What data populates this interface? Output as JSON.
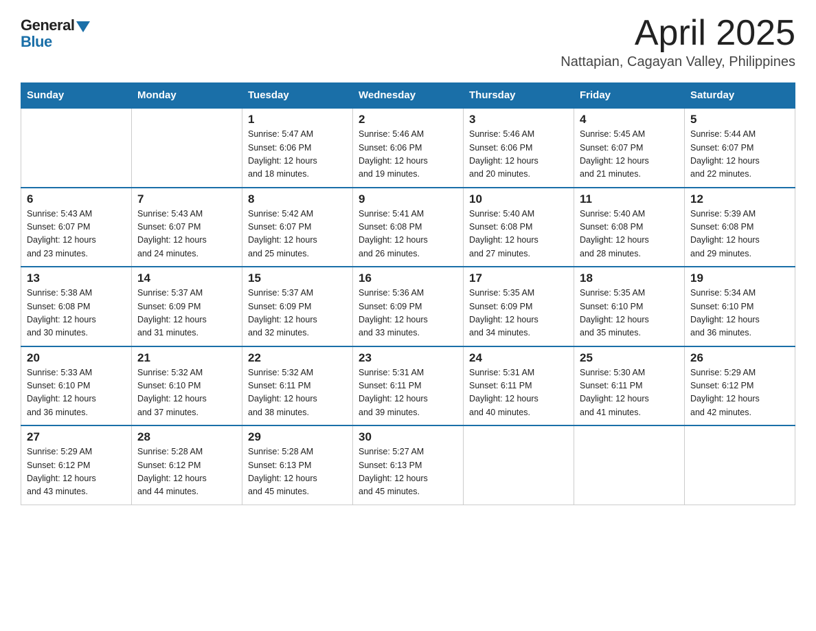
{
  "header": {
    "logo_general": "General",
    "logo_blue": "Blue",
    "title": "April 2025",
    "location": "Nattapian, Cagayan Valley, Philippines"
  },
  "days_of_week": [
    "Sunday",
    "Monday",
    "Tuesday",
    "Wednesday",
    "Thursday",
    "Friday",
    "Saturday"
  ],
  "weeks": [
    [
      {
        "day": "",
        "info": ""
      },
      {
        "day": "",
        "info": ""
      },
      {
        "day": "1",
        "info": "Sunrise: 5:47 AM\nSunset: 6:06 PM\nDaylight: 12 hours\nand 18 minutes."
      },
      {
        "day": "2",
        "info": "Sunrise: 5:46 AM\nSunset: 6:06 PM\nDaylight: 12 hours\nand 19 minutes."
      },
      {
        "day": "3",
        "info": "Sunrise: 5:46 AM\nSunset: 6:06 PM\nDaylight: 12 hours\nand 20 minutes."
      },
      {
        "day": "4",
        "info": "Sunrise: 5:45 AM\nSunset: 6:07 PM\nDaylight: 12 hours\nand 21 minutes."
      },
      {
        "day": "5",
        "info": "Sunrise: 5:44 AM\nSunset: 6:07 PM\nDaylight: 12 hours\nand 22 minutes."
      }
    ],
    [
      {
        "day": "6",
        "info": "Sunrise: 5:43 AM\nSunset: 6:07 PM\nDaylight: 12 hours\nand 23 minutes."
      },
      {
        "day": "7",
        "info": "Sunrise: 5:43 AM\nSunset: 6:07 PM\nDaylight: 12 hours\nand 24 minutes."
      },
      {
        "day": "8",
        "info": "Sunrise: 5:42 AM\nSunset: 6:07 PM\nDaylight: 12 hours\nand 25 minutes."
      },
      {
        "day": "9",
        "info": "Sunrise: 5:41 AM\nSunset: 6:08 PM\nDaylight: 12 hours\nand 26 minutes."
      },
      {
        "day": "10",
        "info": "Sunrise: 5:40 AM\nSunset: 6:08 PM\nDaylight: 12 hours\nand 27 minutes."
      },
      {
        "day": "11",
        "info": "Sunrise: 5:40 AM\nSunset: 6:08 PM\nDaylight: 12 hours\nand 28 minutes."
      },
      {
        "day": "12",
        "info": "Sunrise: 5:39 AM\nSunset: 6:08 PM\nDaylight: 12 hours\nand 29 minutes."
      }
    ],
    [
      {
        "day": "13",
        "info": "Sunrise: 5:38 AM\nSunset: 6:08 PM\nDaylight: 12 hours\nand 30 minutes."
      },
      {
        "day": "14",
        "info": "Sunrise: 5:37 AM\nSunset: 6:09 PM\nDaylight: 12 hours\nand 31 minutes."
      },
      {
        "day": "15",
        "info": "Sunrise: 5:37 AM\nSunset: 6:09 PM\nDaylight: 12 hours\nand 32 minutes."
      },
      {
        "day": "16",
        "info": "Sunrise: 5:36 AM\nSunset: 6:09 PM\nDaylight: 12 hours\nand 33 minutes."
      },
      {
        "day": "17",
        "info": "Sunrise: 5:35 AM\nSunset: 6:09 PM\nDaylight: 12 hours\nand 34 minutes."
      },
      {
        "day": "18",
        "info": "Sunrise: 5:35 AM\nSunset: 6:10 PM\nDaylight: 12 hours\nand 35 minutes."
      },
      {
        "day": "19",
        "info": "Sunrise: 5:34 AM\nSunset: 6:10 PM\nDaylight: 12 hours\nand 36 minutes."
      }
    ],
    [
      {
        "day": "20",
        "info": "Sunrise: 5:33 AM\nSunset: 6:10 PM\nDaylight: 12 hours\nand 36 minutes."
      },
      {
        "day": "21",
        "info": "Sunrise: 5:32 AM\nSunset: 6:10 PM\nDaylight: 12 hours\nand 37 minutes."
      },
      {
        "day": "22",
        "info": "Sunrise: 5:32 AM\nSunset: 6:11 PM\nDaylight: 12 hours\nand 38 minutes."
      },
      {
        "day": "23",
        "info": "Sunrise: 5:31 AM\nSunset: 6:11 PM\nDaylight: 12 hours\nand 39 minutes."
      },
      {
        "day": "24",
        "info": "Sunrise: 5:31 AM\nSunset: 6:11 PM\nDaylight: 12 hours\nand 40 minutes."
      },
      {
        "day": "25",
        "info": "Sunrise: 5:30 AM\nSunset: 6:11 PM\nDaylight: 12 hours\nand 41 minutes."
      },
      {
        "day": "26",
        "info": "Sunrise: 5:29 AM\nSunset: 6:12 PM\nDaylight: 12 hours\nand 42 minutes."
      }
    ],
    [
      {
        "day": "27",
        "info": "Sunrise: 5:29 AM\nSunset: 6:12 PM\nDaylight: 12 hours\nand 43 minutes."
      },
      {
        "day": "28",
        "info": "Sunrise: 5:28 AM\nSunset: 6:12 PM\nDaylight: 12 hours\nand 44 minutes."
      },
      {
        "day": "29",
        "info": "Sunrise: 5:28 AM\nSunset: 6:13 PM\nDaylight: 12 hours\nand 45 minutes."
      },
      {
        "day": "30",
        "info": "Sunrise: 5:27 AM\nSunset: 6:13 PM\nDaylight: 12 hours\nand 45 minutes."
      },
      {
        "day": "",
        "info": ""
      },
      {
        "day": "",
        "info": ""
      },
      {
        "day": "",
        "info": ""
      }
    ]
  ]
}
